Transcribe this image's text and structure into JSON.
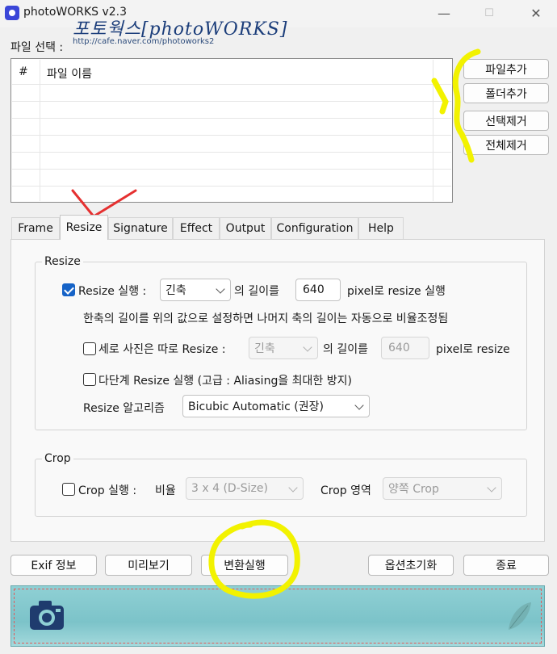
{
  "window": {
    "title": "photoWORKS v2.3",
    "controls": {
      "minimize": "—",
      "maximize": "☐",
      "close": "✕"
    }
  },
  "file_section": {
    "label": "파일 선택 :",
    "columns": [
      "#",
      "파일 이름"
    ],
    "rows": []
  },
  "file_buttons": {
    "add_file": "파일추가",
    "add_folder": "폴더추가",
    "remove_selected": "선택제거",
    "remove_all": "전체제거"
  },
  "tabs": [
    {
      "label": "Frame",
      "active": false
    },
    {
      "label": "Resize",
      "active": true
    },
    {
      "label": "Signature",
      "active": false
    },
    {
      "label": "Effect",
      "active": false
    },
    {
      "label": "Output",
      "active": false
    },
    {
      "label": "Configuration",
      "active": false
    },
    {
      "label": "Help",
      "active": false
    }
  ],
  "resize": {
    "group_title": "Resize",
    "enable_label": "Resize 실행 :",
    "enable_checked": true,
    "axis_value": "긴축",
    "length_label": "의 길이를",
    "length_value": "640",
    "suffix": "pixel로 resize 실행",
    "hint": "한축의 길이를 위의 값으로 설정하면 나머지 축의 길이는 자동으로 비율조정됨",
    "portrait_label": "세로 사진은 따로 Resize :",
    "portrait_checked": false,
    "portrait_axis": "긴축",
    "portrait_length_label": "의 길이를",
    "portrait_length_value": "640",
    "portrait_suffix": "pixel로 resize",
    "multistep_label": "다단계 Resize 실행 (고급 : Aliasing을 최대한 방지)",
    "multistep_checked": false,
    "algorithm_label": "Resize 알고리즘",
    "algorithm_value": "Bicubic Automatic (권장)"
  },
  "crop": {
    "group_title": "Crop",
    "enable_label": "Crop 실행 :",
    "enable_checked": false,
    "ratio_label": "비율",
    "ratio_value": "3 x 4 (D-Size)",
    "area_label": "Crop 영역",
    "area_value": "양쪽 Crop"
  },
  "bottom_buttons": {
    "exif": "Exif 정보",
    "preview": "미리보기",
    "convert": "변환실행",
    "reset_options": "옵션초기화",
    "exit": "종료"
  },
  "banner": {
    "title": "포토웍스[photoWORKS]",
    "url": "http://cafe.naver.com/photoworks2"
  },
  "colors": {
    "accent": "#1663c7",
    "annotation_yellow": "#f2f200",
    "annotation_red": "#e53030"
  }
}
